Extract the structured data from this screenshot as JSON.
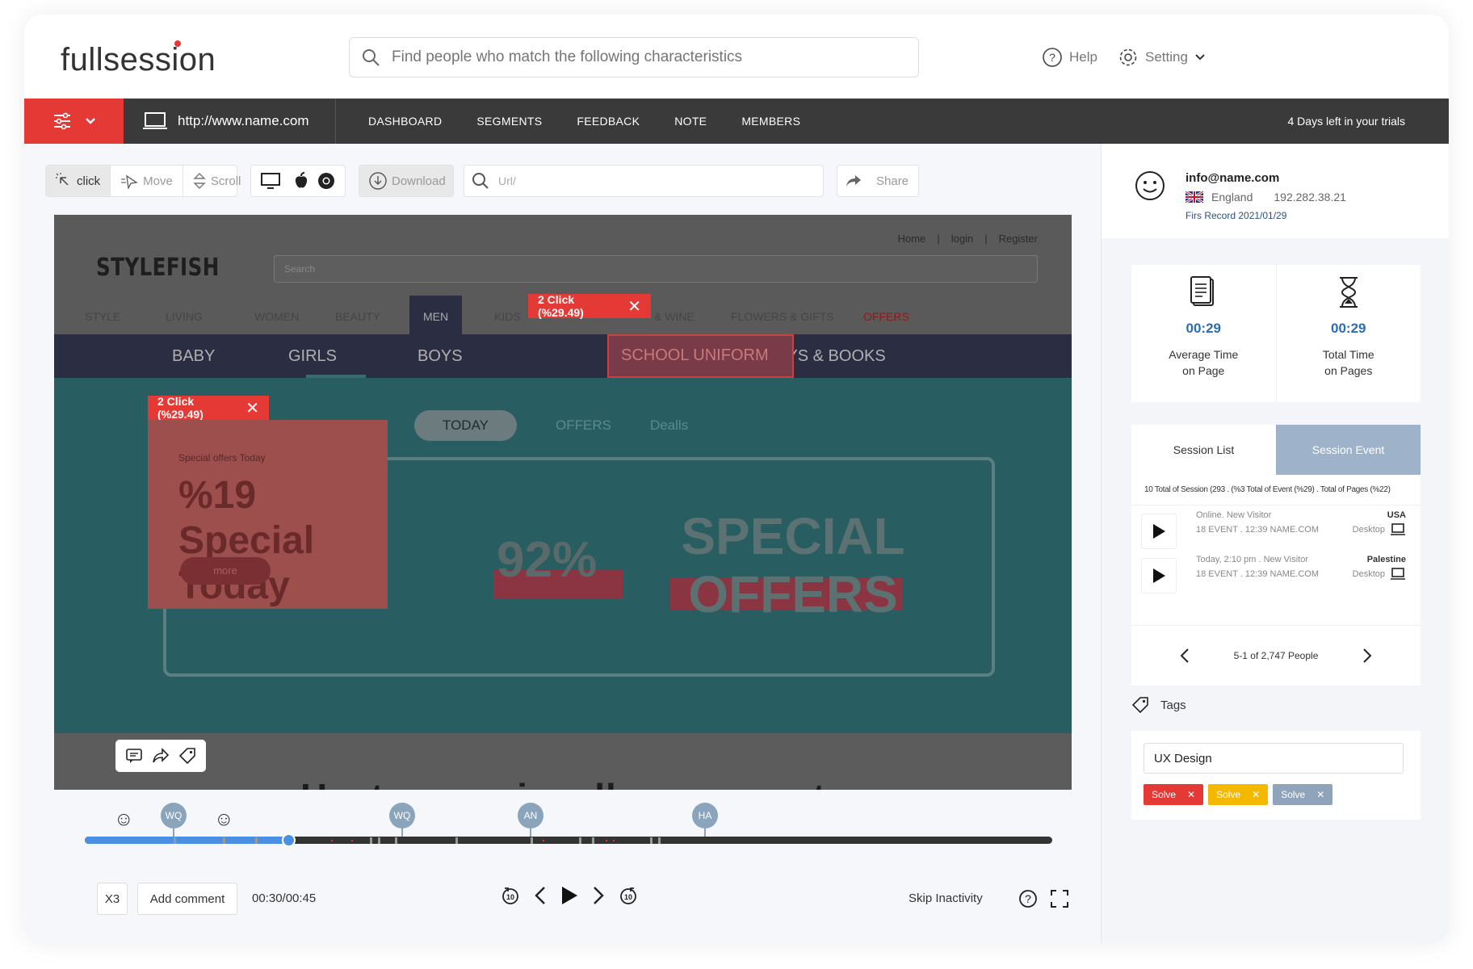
{
  "app": {
    "logo_full": "full",
    "logo_session": "session"
  },
  "search": {
    "placeholder": "Find people who match the following characteristics"
  },
  "topbar": {
    "help": "Help",
    "setting": "Setting"
  },
  "nav": {
    "url": "http://www.name.com",
    "links": [
      "DASHBOARD",
      "SEGMENTS",
      "FEEDBACK",
      "NOTE",
      "MEMBERS"
    ],
    "trial": "4 Days left in your trials"
  },
  "toolbar": {
    "modes": [
      "click",
      "Move",
      "Scroll"
    ],
    "download": "Download",
    "url_placeholder": "Url/",
    "share": "Share"
  },
  "site": {
    "header_links": [
      "Home",
      "|",
      "login",
      "|",
      "Register"
    ],
    "brand": "STYLEFISH",
    "search_placeholder": "Search",
    "categories": [
      "STYLE",
      "LIVING",
      "WOMEN",
      "BEAUTY",
      "MEN",
      "KIDS",
      "& WINE",
      "FLOWERS & GIFTS",
      "OFFERS"
    ],
    "subnav": [
      "BABY",
      "GIRLS",
      "BOYS",
      "SCHOOL UNIFORM",
      "TOYS & BOOKS"
    ],
    "pills": [
      "TODAY",
      "OFFERS",
      "Dealls"
    ],
    "offer_small": "Special offers Today",
    "offer_big_1": "%19 Special",
    "offer_big_2": "Today",
    "more": "more",
    "pct": "92%",
    "special_1": "SPECIAL",
    "special_2": "OFFERS",
    "partial_heading": "Heatmaps visually represent"
  },
  "heat_badges": [
    {
      "label": "2 Click (%29.49)",
      "close": "✕"
    },
    {
      "label": "2 Click (%29.49)",
      "close": "✕"
    }
  ],
  "timeline": {
    "progress": 0.21,
    "markers": [
      "WQ",
      "WQ",
      "AN",
      "HA"
    ]
  },
  "controls": {
    "speed": "X3",
    "add_comment": "Add comment",
    "time": "00:30/00:45",
    "skip": "Skip Inactivity"
  },
  "user": {
    "email": "info@name.com",
    "country": "England",
    "ip": "192.282.38.21",
    "first_record": "Firs Record 2021/01/29"
  },
  "stats": [
    {
      "value": "00:29",
      "label1": "Average Time",
      "label2": "on Page"
    },
    {
      "value": "00:29",
      "label1": "Total Time",
      "label2": "on Pages"
    }
  ],
  "sessions": {
    "tabs": [
      "Session List",
      "Session Event"
    ],
    "summary": "10 Total of Session (293 . (%3 Total of Event (%29) . Total of Pages (%22)",
    "rows": [
      {
        "line1": "Online. New Visitor",
        "line2": "18 EVENT . 12:39 NAME.COM",
        "country": "USA",
        "device": "Desktop"
      },
      {
        "line1": "Today, 2:10 pm . New Visitor",
        "line2": "18 EVENT . 12:39 NAME.COM",
        "country": "Palestine",
        "device": "Desktop"
      }
    ],
    "pager": "5-1 of 2,747 People"
  },
  "tags": {
    "title": "Tags",
    "input_value": "UX Design",
    "chips": [
      {
        "label": "Solve",
        "color": "#e53935"
      },
      {
        "label": "Solve",
        "color": "#f5b800"
      },
      {
        "label": "Solve",
        "color": "#8fa3bb"
      }
    ]
  }
}
